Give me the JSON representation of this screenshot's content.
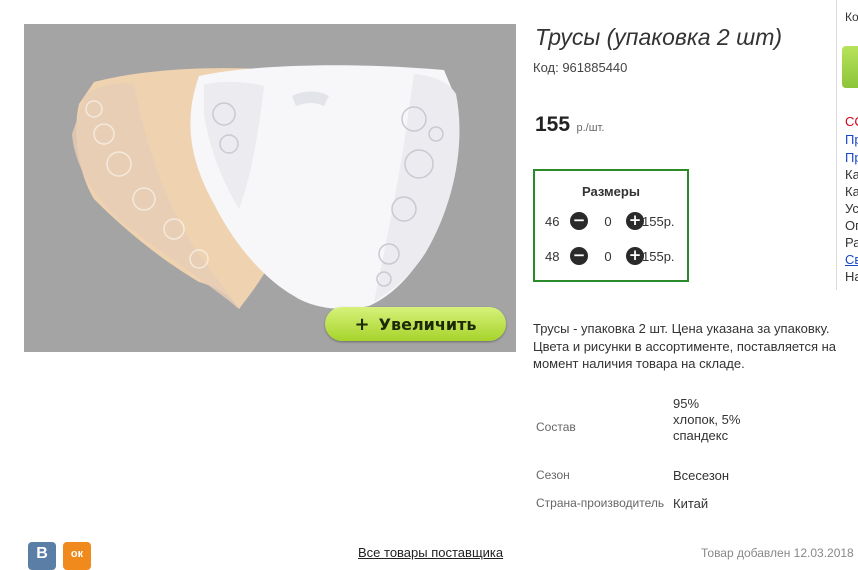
{
  "product": {
    "title": "Трусы (упаковка 2 шт)",
    "code": "Код: 961885440",
    "price": "155",
    "price_unit": "р./шт."
  },
  "photo": {
    "zoom_label": "Увеличить",
    "zoom_plus": "+"
  },
  "sizes": {
    "title": "Размеры",
    "rows": [
      {
        "size": "46",
        "qty": "0",
        "price": "155р."
      },
      {
        "size": "48",
        "qty": "0",
        "price": "155р."
      }
    ],
    "minus_glyph": "−",
    "plus_glyph": "+"
  },
  "description": "Трусы - упаковка 2 шт. Цена указана за упаковку. Цвета и рисунки в ассортименте, поставляется на момент наличия товара на складе.",
  "specs": [
    {
      "label": "Состав",
      "value": "95% хлопок, 5% спандекс"
    },
    {
      "label": "Сезон",
      "value": "Всесезон"
    },
    {
      "label": "Страна-производитель",
      "value": "Китай"
    }
  ],
  "social": {
    "vk": "В",
    "ok": "ок"
  },
  "footer": {
    "all_goods_link": "Все товары поставщика",
    "added": "Товар добавлен 12.03.2018"
  },
  "right_column": {
    "top": "Ко",
    "lines": [
      {
        "text": "СС",
        "style": "red"
      },
      {
        "text": "Пр",
        "style": "blue"
      },
      {
        "text": "Пр",
        "style": "blue"
      },
      {
        "text": "Ка",
        "style": "dark"
      },
      {
        "text": "Ка",
        "style": "dark"
      },
      {
        "text": "Ус",
        "style": "dark"
      },
      {
        "text": "Оп",
        "style": "dark"
      },
      {
        "text": "Ра",
        "style": "dark"
      },
      {
        "text": "Св",
        "style": "blue-u"
      },
      {
        "text": "На",
        "style": "dark"
      }
    ]
  },
  "colors": {
    "accent_green": "#2b8b2b",
    "zoom_button": "#a7d32b",
    "photo_bg": "#a4a4a4"
  }
}
